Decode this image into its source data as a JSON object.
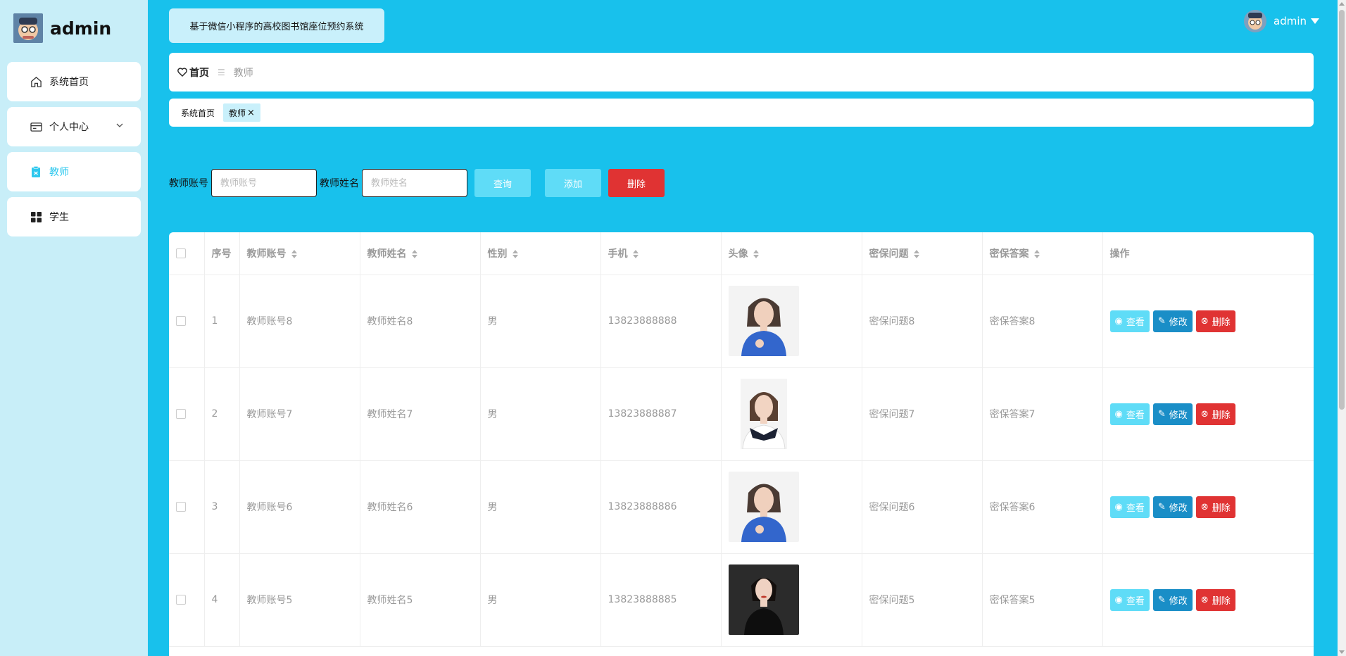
{
  "app": {
    "brand_name": "admin",
    "system_title": "基于微信小程序的高校图书馆座位预约系统",
    "user_name": "admin"
  },
  "sidebar": {
    "items": [
      {
        "label": "系统首页",
        "icon": "home-icon"
      },
      {
        "label": "个人中心",
        "icon": "id-card-icon"
      },
      {
        "label": "教师",
        "icon": "clipboard-icon"
      },
      {
        "label": "学生",
        "icon": "grid-icon"
      }
    ]
  },
  "breadcrumb": {
    "home": "首页",
    "current": "教师"
  },
  "tags": {
    "home": "系统首页",
    "current": "教师"
  },
  "search": {
    "account_label": "教师账号",
    "account_placeholder": "教师账号",
    "name_label": "教师姓名",
    "name_placeholder": "教师姓名",
    "query_button": "查询",
    "add_button": "添加",
    "delete_button": "删除"
  },
  "table": {
    "headers": {
      "index": "序号",
      "account": "教师账号",
      "name": "教师姓名",
      "gender": "性别",
      "phone": "手机",
      "avatar": "头像",
      "question": "密保问题",
      "answer": "密保答案",
      "actions": "操作"
    },
    "action_labels": {
      "view": "查看",
      "edit": "修改",
      "delete": "删除"
    },
    "rows": [
      {
        "index": "1",
        "account": "教师账号8",
        "name": "教师姓名8",
        "gender": "男",
        "phone": "13823888888",
        "question": "密保问题8",
        "answer": "密保答案8"
      },
      {
        "index": "2",
        "account": "教师账号7",
        "name": "教师姓名7",
        "gender": "男",
        "phone": "13823888887",
        "question": "密保问题7",
        "answer": "密保答案7"
      },
      {
        "index": "3",
        "account": "教师账号6",
        "name": "教师姓名6",
        "gender": "男",
        "phone": "13823888886",
        "question": "密保问题6",
        "answer": "密保答案6"
      },
      {
        "index": "4",
        "account": "教师账号5",
        "name": "教师姓名5",
        "gender": "男",
        "phone": "13823888885",
        "question": "密保问题5",
        "answer": "密保答案5"
      }
    ]
  },
  "colors": {
    "background": "#18c1ec",
    "sidebar": "#c8eef8",
    "accent": "#5fdcf7",
    "edit": "#1a8ec7",
    "danger": "#e03333"
  }
}
